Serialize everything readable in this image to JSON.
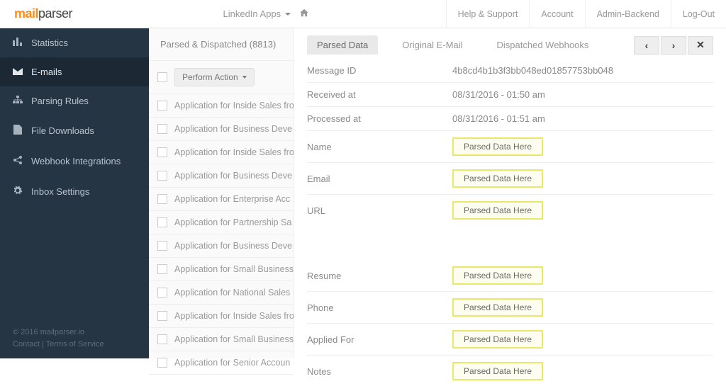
{
  "brand": {
    "prefix_orange": "mail",
    "suffix": "parser"
  },
  "top": {
    "dropdown": "LinkedIn Apps",
    "links": [
      "Help & Support",
      "Account",
      "Admin-Backend",
      "Log-Out"
    ]
  },
  "sidebar": {
    "items": [
      {
        "label": "Statistics"
      },
      {
        "label": "E-mails"
      },
      {
        "label": "Parsing Rules"
      },
      {
        "label": "File Downloads"
      },
      {
        "label": "Webhook Integrations"
      },
      {
        "label": "Inbox Settings"
      }
    ],
    "footer1": "© 2016 mailparser.io",
    "footer2": "Contact | Terms of Service"
  },
  "list": {
    "header": "Parsed & Dispatched (8813)",
    "action": "Perform Action",
    "rows": [
      "Application for Inside Sales fro",
      "Application for Business Deve",
      "Application for Inside Sales fro",
      "Application for Business Deve",
      "Application for Enterprise Acc",
      "Application for Partnership Sa",
      "Application for Business Deve",
      "Application for Small Business",
      "Application for National Sales",
      "Application for Inside Sales fro",
      "Application for Small Business",
      "Application for Senior Accoun"
    ]
  },
  "detail": {
    "tabs": [
      "Parsed Data",
      "Original E-Mail",
      "Dispatched Webhooks"
    ],
    "fields1": [
      {
        "label": "Message ID",
        "value": "4b8cd4b1b3f3bb048ed01857753bb048"
      },
      {
        "label": "Received at",
        "value": "08/31/2016 - 01:50 am"
      },
      {
        "label": "Processed at",
        "value": "08/31/2016 - 01:51 am"
      }
    ],
    "parsed_placeholder": "Parsed Data Here",
    "fields2": [
      {
        "label": "Name"
      },
      {
        "label": "Email"
      },
      {
        "label": "URL"
      }
    ],
    "fields3": [
      {
        "label": "Resume"
      },
      {
        "label": "Phone"
      },
      {
        "label": "Applied For"
      },
      {
        "label": "Notes"
      }
    ]
  }
}
